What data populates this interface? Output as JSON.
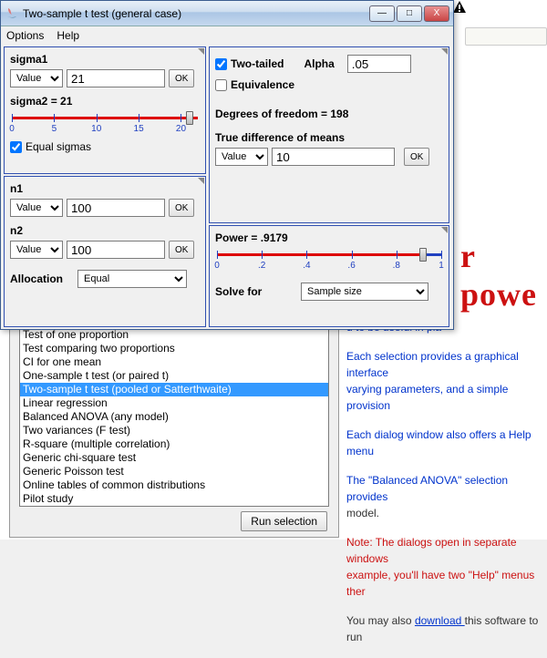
{
  "window": {
    "title": "Two-sample t test (general case)",
    "menu": {
      "options": "Options",
      "help": "Help"
    },
    "buttons": {
      "min": "—",
      "max": "□",
      "close": "X"
    }
  },
  "sigma": {
    "label1": "sigma1",
    "combo": "Value",
    "value1": "21",
    "ok": "OK",
    "label2": "sigma2 = 21",
    "slider": {
      "min": 0,
      "max": 22,
      "ticks": [
        0,
        5,
        10,
        15,
        20
      ],
      "value": 21
    },
    "equal_label": "Equal sigmas",
    "equal_checked": true
  },
  "n": {
    "label1": "n1",
    "combo": "Value",
    "value1": "100",
    "ok": "OK",
    "label2": "n2",
    "value2": "100",
    "alloc_label": "Allocation",
    "alloc_value": "Equal"
  },
  "top": {
    "twotailed_label": "Two-tailed",
    "twotailed_checked": true,
    "alpha_label": "Alpha",
    "alpha_value": ".05",
    "equiv_label": "Equivalence",
    "equiv_checked": false,
    "dof_label": "Degrees of freedom = 198",
    "truediff_label": "True difference of means",
    "combo": "Value",
    "truediff_value": "10",
    "ok": "OK"
  },
  "power": {
    "label": "Power = .9179",
    "slider": {
      "min": 0,
      "max": 1,
      "ticks": [
        0,
        0.2,
        0.4,
        0.6,
        0.8,
        1
      ],
      "tick_labels": [
        "0",
        ".2",
        ".4",
        ".6",
        ".8",
        "1"
      ],
      "value": 0.9179
    },
    "solve_label": "Solve for",
    "solve_value": "Sample size"
  },
  "list": {
    "items": [
      "Test of one proportion",
      "Test comparing two proportions",
      "CI for one mean",
      "One-sample t test (or paired t)",
      "Two-sample t test (pooled or Satterthwaite)",
      "Linear regression",
      "Balanced ANOVA (any model)",
      "Two variances (F test)",
      "R-square (multiple correlation)",
      "Generic chi-square test",
      "Generic Poisson test",
      "Online tables of common distributions",
      "Pilot study"
    ],
    "selected_index": 4,
    "run": "Run selection"
  },
  "bg": {
    "title_fragment": "r powe",
    "line0": "d to be useful in pla",
    "line1a": "Each selection provides a graphical interface",
    "line1b": "varying parameters, and a simple provision",
    "line2": "Each dialog window also offers a Help menu",
    "line3a": "The \"Balanced ANOVA\" selection provides",
    "line3b": "model.",
    "line4a": "Note: The dialogs open in separate windows",
    "line4b": "example, you'll have two \"Help\" menus ther",
    "line5a": "You may also ",
    "line5link": "download ",
    "line5b": "this software to run"
  }
}
